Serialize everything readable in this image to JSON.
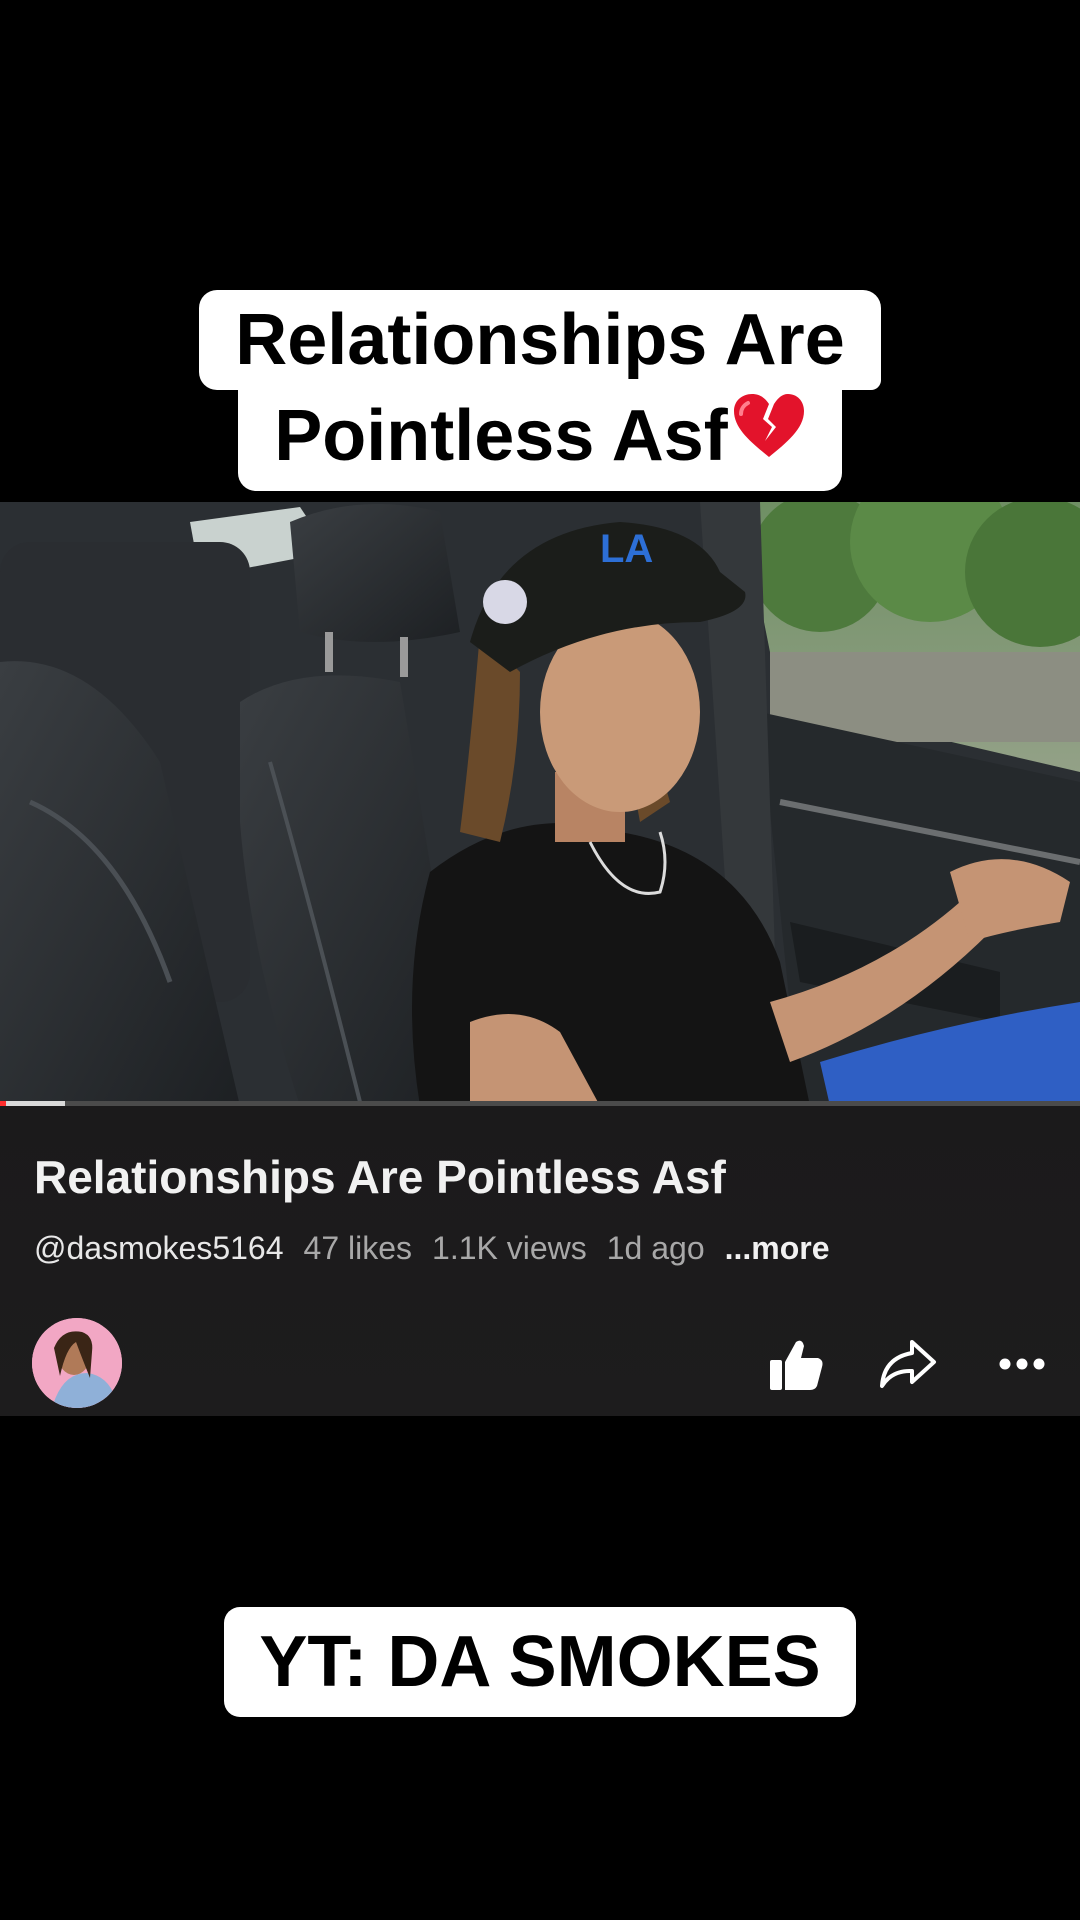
{
  "caption_top": {
    "line1": "Relationships Are",
    "line2": "Pointless Asf",
    "emoji": "broken-heart-icon"
  },
  "video": {
    "progress": 0.06
  },
  "info": {
    "title": "Relationships Are Pointless Asf",
    "channel": "@dasmokes5164",
    "likes": "47 likes",
    "views": "1.1K views",
    "age": "1d ago",
    "more": "...more"
  },
  "actions": {
    "like_icon": "thumbs-up-icon",
    "share_icon": "share-arrow-icon",
    "more_icon": "more-dots-icon"
  },
  "caption_bottom": {
    "text": "YT: DA SMOKES"
  },
  "colors": {
    "background": "#000000",
    "caption_bg": "#ffffff",
    "panel_bg": "#1b1a1b",
    "progress_accent": "#ff2d2d"
  }
}
